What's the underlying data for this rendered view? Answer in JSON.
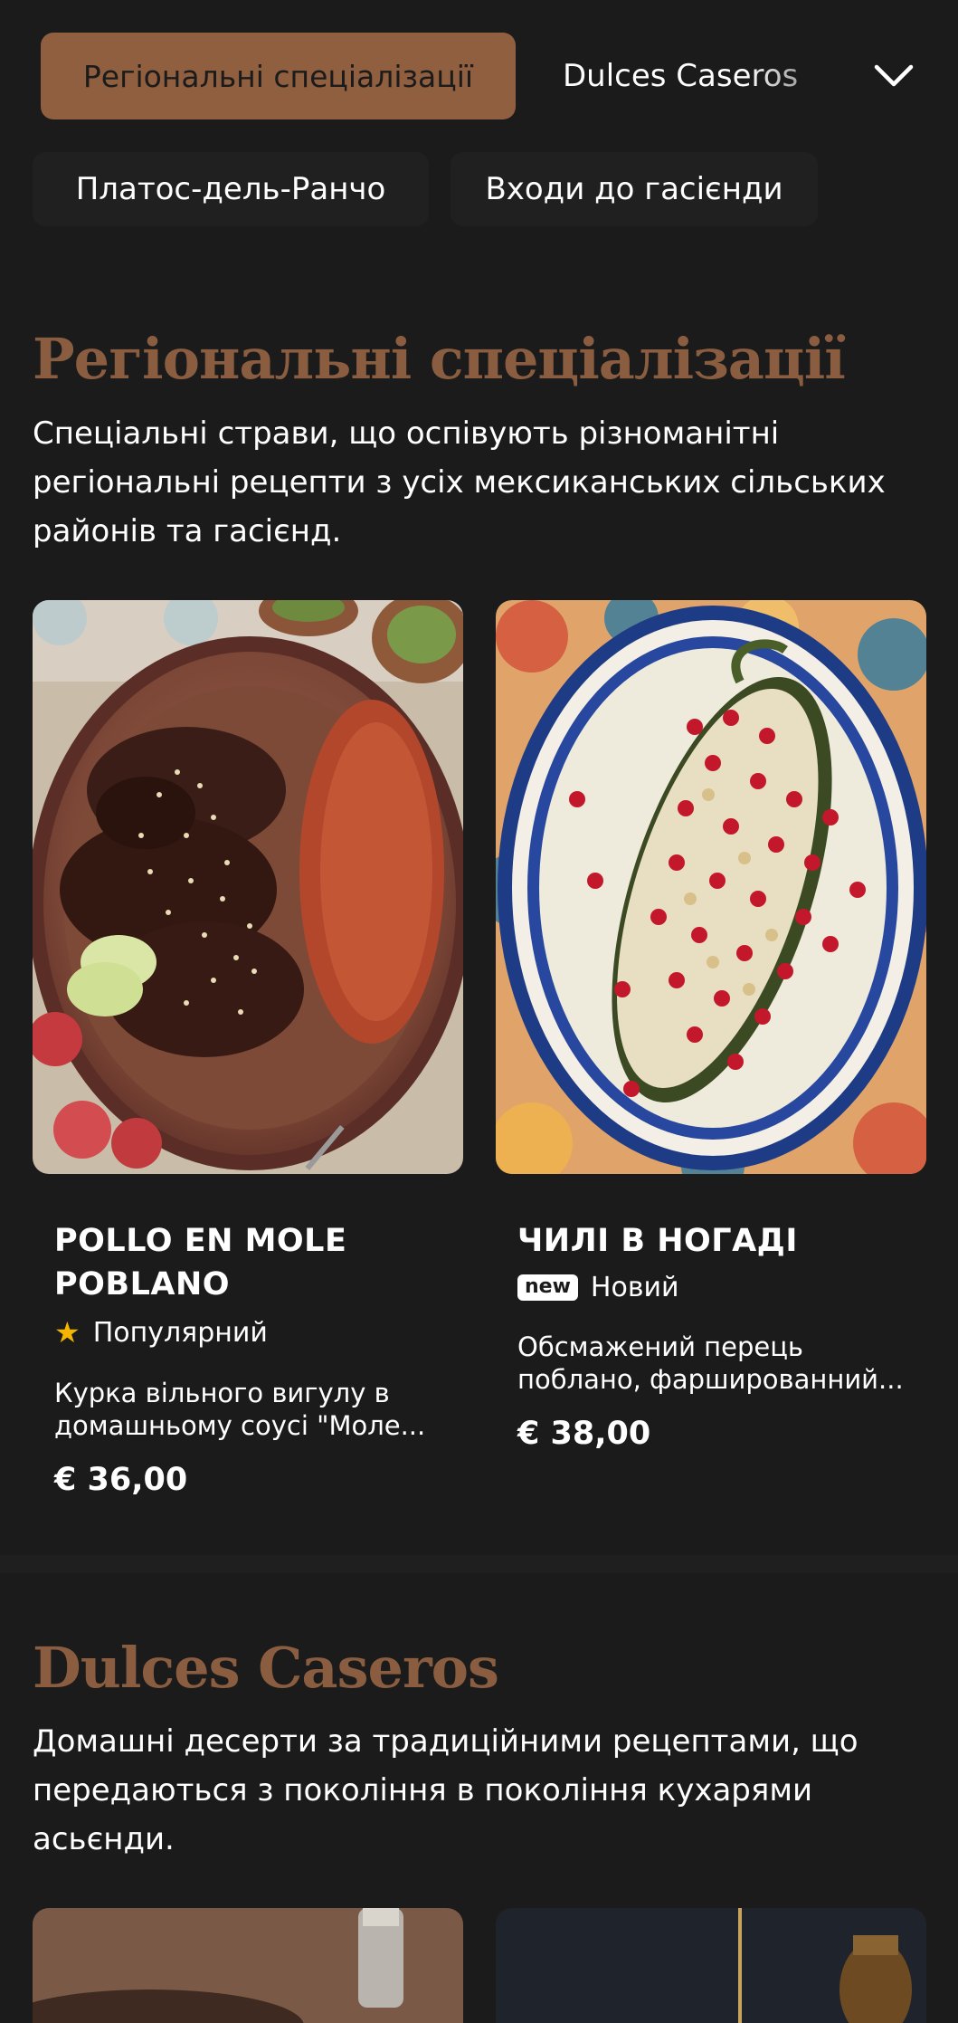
{
  "nav": {
    "active_category": "Регіональні спеціалізації",
    "next_category": "Dulces Caseros",
    "toggle_icon": "chevron-down-icon",
    "row2": [
      "Платос-дель-Ранчо",
      "Входи до гасієнди"
    ]
  },
  "sections": [
    {
      "title": "Регіональні спеціалізації",
      "description": "Спеціальні страви, що оспівують різноманітні регіональні рецепти з усіх мексиканських сільських районів та гасієнд.",
      "items": [
        {
          "name": "POLLO EN MOLE POBLANO",
          "tag_icon": "star-icon",
          "tag_label": "Популярний",
          "description": "Курка вільного вигулу в домашньому соусі \"Моле...",
          "price": "€ 36,00"
        },
        {
          "name": "ЧИЛІ В НОГАДІ",
          "tag_badge": "new",
          "tag_label": "Новий",
          "description": "Обсмажений перець поблано, фаршированний...",
          "price": "€ 38,00"
        }
      ]
    },
    {
      "title": "Dulces Caseros",
      "description": "Домашні десерти за традиційними рецептами, що передаються з покоління в покоління кухарями асьєнди."
    }
  ],
  "colors": {
    "background": "#1b1b1b",
    "accent": "#8f5f3f",
    "heading": "#8a5d40",
    "star": "#f4b400"
  }
}
